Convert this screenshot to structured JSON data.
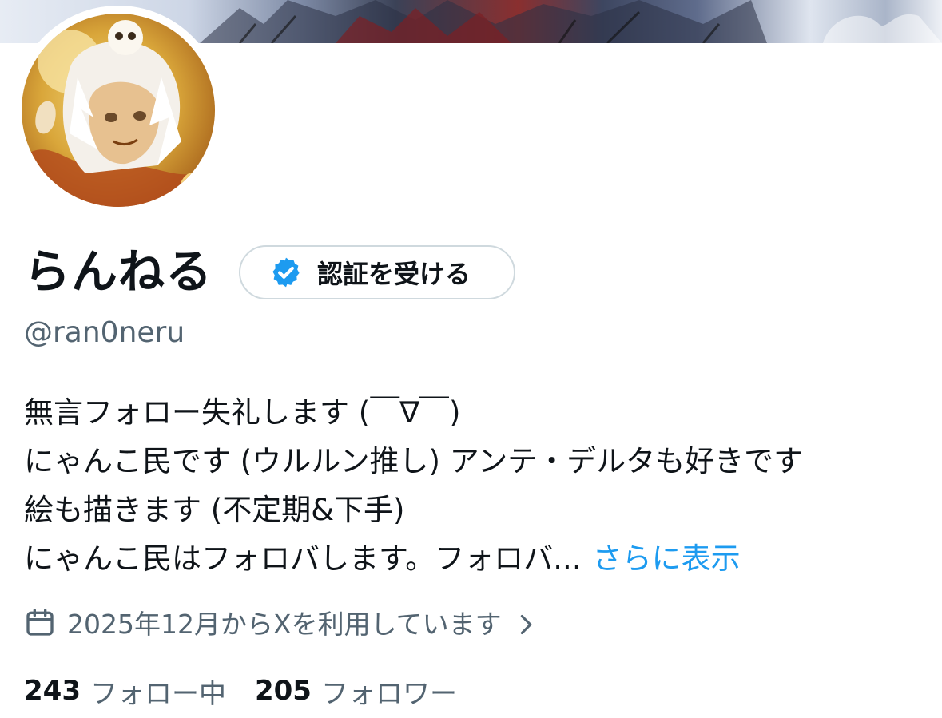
{
  "profile": {
    "display_name": "らんねる",
    "handle": "@ran0neru",
    "verify_button": {
      "label": "認証を受ける",
      "icon": "verified-badge-icon"
    },
    "bio": {
      "lines": [
        "無言フォロー失礼します (￣∇￣)",
        "にゃんこ民です (ウルルン推し) アンテ・デルタも好きです",
        "絵も描きます (不定期&下手)",
        "にゃんこ民はフォロバします。フォロバ..."
      ],
      "show_more": "さらに表示"
    },
    "joined": {
      "text": "2025年12月からXを利用しています",
      "icon": "calendar-icon",
      "chevron": "chevron-right-icon"
    },
    "stats": {
      "following_count": "243",
      "following_label": "フォロー中",
      "followers_count": "205",
      "followers_label": "フォロワー"
    }
  },
  "colors": {
    "text_primary": "#0f1419",
    "text_secondary": "#536471",
    "link": "#1d9bf0",
    "verified_badge": "#1d9bf0",
    "button_border": "#cfd9de"
  }
}
